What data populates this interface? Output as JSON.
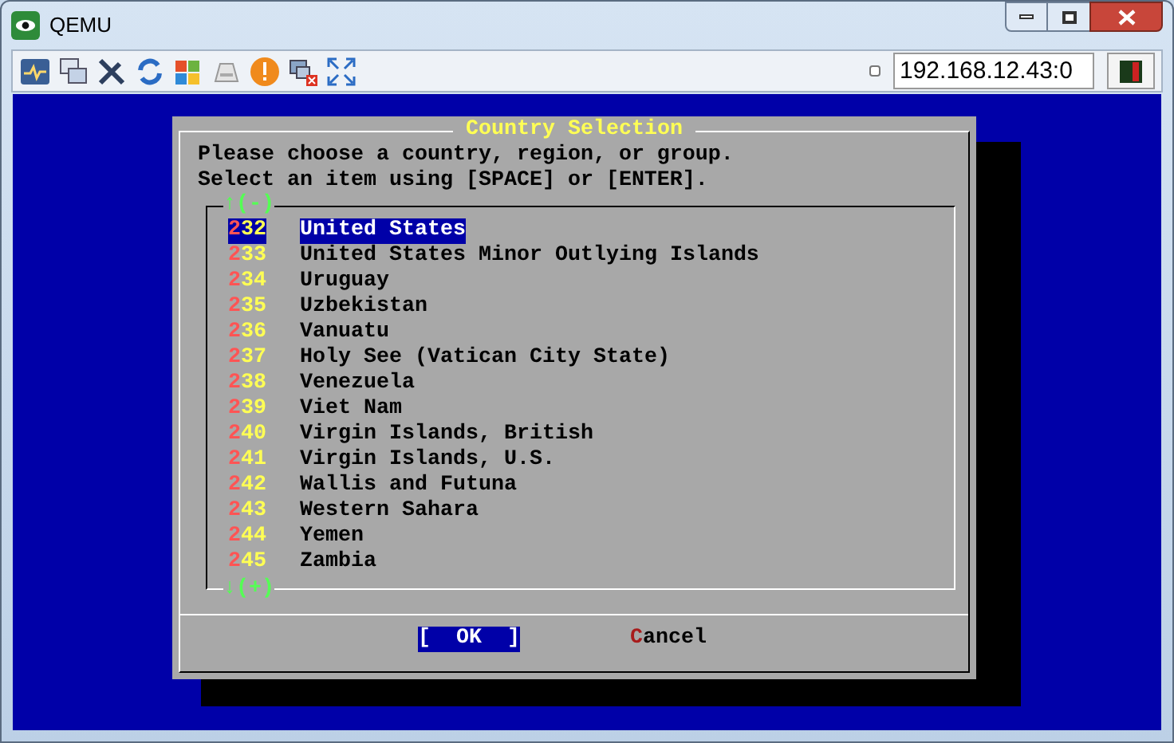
{
  "window": {
    "title": "QEMU",
    "address": "192.168.12.43:0"
  },
  "dialog": {
    "title": "Country Selection",
    "prompt": [
      "Please choose a country, region, or group.",
      "Select an item using [SPACE] or [ENTER]."
    ],
    "scroll_up": "↑(-)",
    "scroll_down": "↓(+)",
    "items": [
      {
        "number": "232",
        "name": "United States",
        "selected": true
      },
      {
        "number": "233",
        "name": "United States Minor Outlying Islands",
        "selected": false
      },
      {
        "number": "234",
        "name": "Uruguay",
        "selected": false
      },
      {
        "number": "235",
        "name": "Uzbekistan",
        "selected": false
      },
      {
        "number": "236",
        "name": "Vanuatu",
        "selected": false
      },
      {
        "number": "237",
        "name": "Holy See (Vatican City State)",
        "selected": false
      },
      {
        "number": "238",
        "name": "Venezuela",
        "selected": false
      },
      {
        "number": "239",
        "name": "Viet Nam",
        "selected": false
      },
      {
        "number": "240",
        "name": "Virgin Islands, British",
        "selected": false
      },
      {
        "number": "241",
        "name": "Virgin Islands, U.S.",
        "selected": false
      },
      {
        "number": "242",
        "name": "Wallis and Futuna",
        "selected": false
      },
      {
        "number": "243",
        "name": "Western Sahara",
        "selected": false
      },
      {
        "number": "244",
        "name": "Yemen",
        "selected": false
      },
      {
        "number": "245",
        "name": "Zambia",
        "selected": false
      }
    ],
    "buttons": [
      {
        "label": "[  OK  ]",
        "selected": true
      },
      {
        "label": "Cancel",
        "selected": false
      }
    ]
  }
}
